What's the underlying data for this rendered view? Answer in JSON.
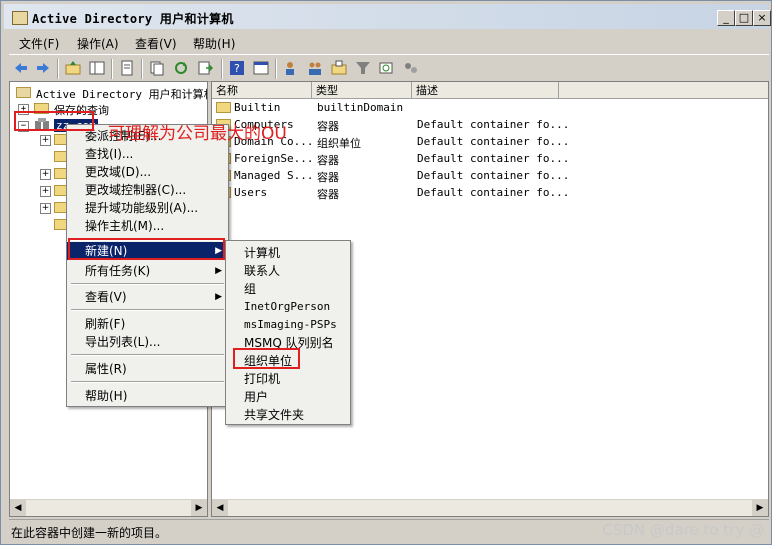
{
  "window": {
    "title": "Active Directory 用户和计算机",
    "minimize": "_",
    "maximize": "□",
    "close": "×"
  },
  "menubar": [
    "文件(F)",
    "操作(A)",
    "查看(V)",
    "帮助(H)"
  ],
  "tree": {
    "root": "Active Directory 用户和计算机",
    "saved_queries": "保存的查询",
    "domain": "zz.com"
  },
  "annotation": "可理解为公司最大的OU",
  "columns": [
    "名称",
    "类型",
    "描述"
  ],
  "rows": [
    {
      "name": "Builtin",
      "type": "builtinDomain",
      "desc": ""
    },
    {
      "name": "Computers",
      "type": "容器",
      "desc": "Default container fo..."
    },
    {
      "name": "Domain Co...",
      "type": "组织单位",
      "desc": "Default container fo..."
    },
    {
      "name": "ForeignSe...",
      "type": "容器",
      "desc": "Default container fo..."
    },
    {
      "name": "Managed S...",
      "type": "容器",
      "desc": "Default container fo..."
    },
    {
      "name": "Users",
      "type": "容器",
      "desc": "Default container fo..."
    }
  ],
  "context_menu": {
    "items": [
      "委派控制(E)...",
      "查找(I)...",
      "更改域(D)...",
      "更改域控制器(C)...",
      "提升域功能级别(A)...",
      "操作主机(M)...",
      "新建(N)",
      "所有任务(K)",
      "查看(V)",
      "刷新(F)",
      "导出列表(L)...",
      "属性(R)",
      "帮助(H)"
    ]
  },
  "submenu": {
    "items": [
      "计算机",
      "联系人",
      "组",
      "InetOrgPerson",
      "msImaging-PSPs",
      "MSMQ 队列别名",
      "组织单位",
      "打印机",
      "用户",
      "共享文件夹"
    ]
  },
  "status": "在此容器中创建一新的项目。",
  "watermark": "CSDN @dare to try @"
}
